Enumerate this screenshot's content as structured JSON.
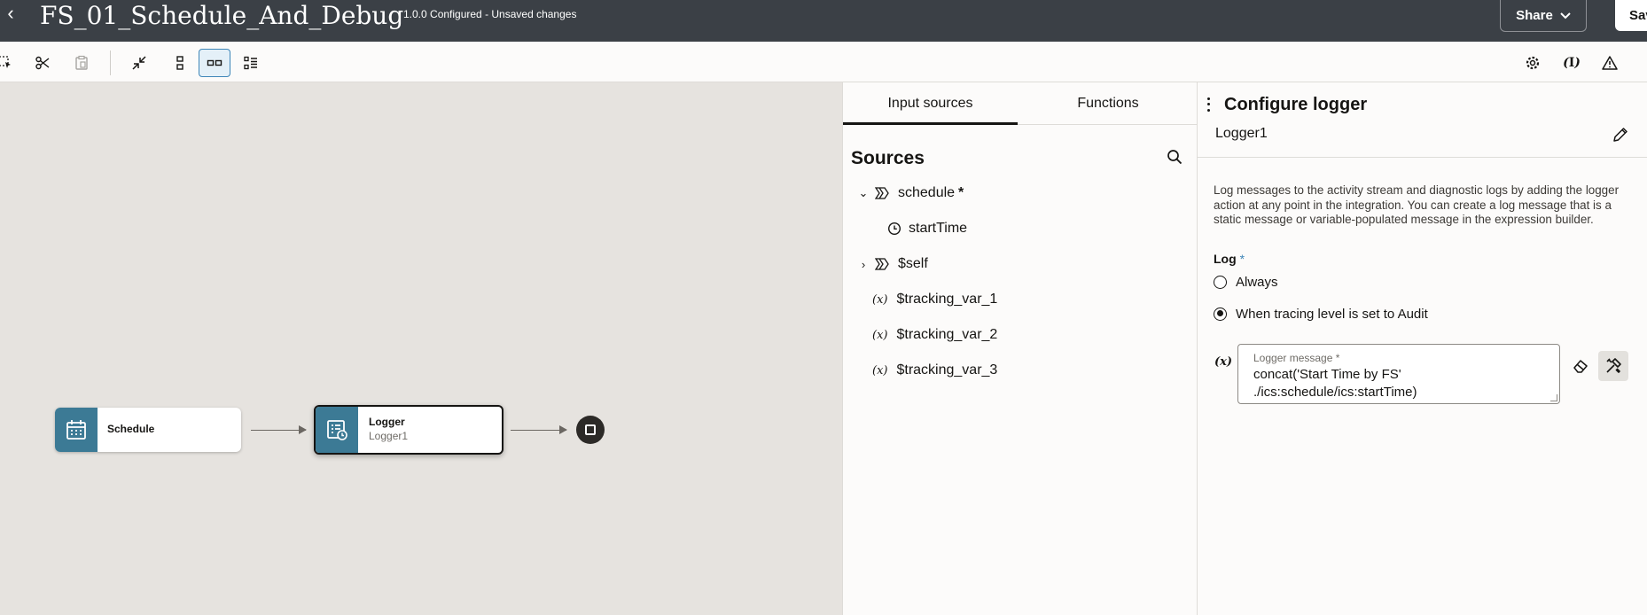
{
  "header": {
    "title": "FS_01_Schedule_And_Debug",
    "status": "1.0.0 Configured - Unsaved changes",
    "share_label": "Share",
    "save_label": "Save"
  },
  "toolbar": {
    "items": [
      "select-icon",
      "cut-icon",
      "paste-icon",
      "collapse-icon",
      "vertical-layout-icon",
      "horizontal-layout-icon",
      "list-layout-icon",
      "settings-icon",
      "variables-icon",
      "warning-icon"
    ],
    "active_item": "horizontal-layout-icon"
  },
  "canvas": {
    "nodes": [
      {
        "label": "Schedule",
        "sub": ""
      },
      {
        "label": "Logger",
        "sub": "Logger1"
      }
    ],
    "accent_color": "#3c7a95"
  },
  "mapper": {
    "tabs": [
      "Input sources",
      "Functions"
    ],
    "active_tab": "Input sources",
    "sources_title": "Sources",
    "tree": [
      {
        "label": "schedule",
        "marker": "*",
        "expanded": true
      },
      {
        "label": "startTime"
      },
      {
        "label": "$self",
        "expanded": false
      },
      {
        "label": "$tracking_var_1"
      },
      {
        "label": "$tracking_var_2"
      },
      {
        "label": "$tracking_var_3"
      }
    ],
    "var_glyph": "(x)"
  },
  "config": {
    "title": "Configure logger",
    "name": "Logger1",
    "description": "Log messages to the activity stream and diagnostic logs by adding the logger action at any point in the integration. You can create a log message that is a static message or variable-populated message in the expression builder.",
    "log_label": "Log",
    "required_mark": "*",
    "options": [
      "Always",
      "When tracing level is set to Audit"
    ],
    "selected_option": "When tracing level is set to Audit",
    "expr_glyph": "(x)",
    "message_label": "Logger message *",
    "message_value": "concat('Start Time by FS'\n./ics:schedule/ics:startTime)"
  }
}
